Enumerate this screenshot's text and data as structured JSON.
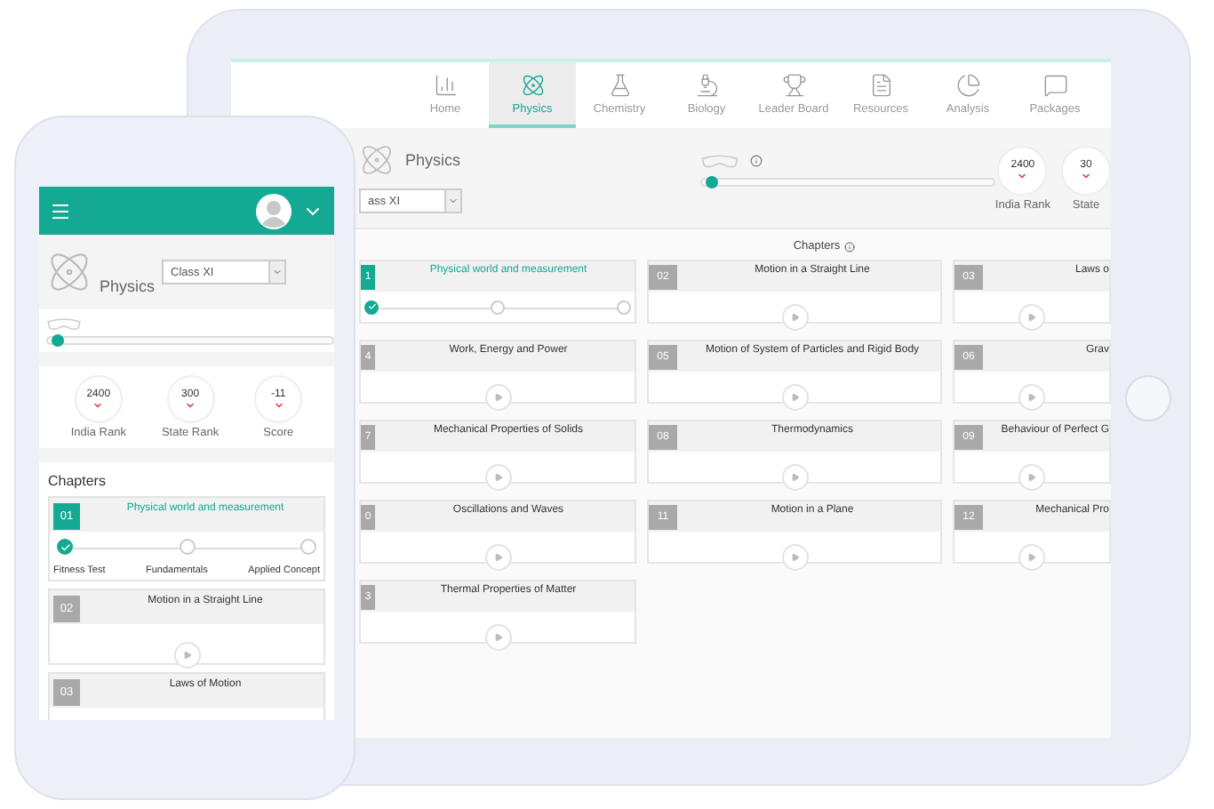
{
  "tablet": {
    "nav": [
      {
        "label": "Home",
        "selected": false
      },
      {
        "label": "Physics",
        "selected": true
      },
      {
        "label": "Chemistry",
        "selected": false
      },
      {
        "label": "Biology",
        "selected": false
      },
      {
        "label": "Leader Board",
        "selected": false
      },
      {
        "label": "Resources",
        "selected": false
      },
      {
        "label": "Analysis",
        "selected": false
      },
      {
        "label": "Packages",
        "selected": false
      }
    ],
    "header": {
      "subject": "Physics",
      "class_select": "ass XI",
      "progress": {
        "level": 0.02
      },
      "stats": [
        {
          "value": "2400",
          "label": "India Rank"
        },
        {
          "value": "30",
          "label": "State"
        }
      ]
    },
    "chapters_title": "Chapters",
    "chapters": [
      {
        "number": "1",
        "title": "Physical world and measurement",
        "selected": true,
        "steps": [
          {
            "done": true
          },
          {
            "done": false
          },
          {
            "done": false
          }
        ]
      },
      {
        "number": "02",
        "title": "Motion in a Straight Line",
        "selected": false
      },
      {
        "number": "03",
        "title": "Laws o",
        "selected": false
      },
      {
        "number": "4",
        "title": "Work, Energy and Power",
        "selected": false
      },
      {
        "number": "05",
        "title": "Motion of System of Particles and Rigid Body",
        "selected": false
      },
      {
        "number": "06",
        "title": "Grav",
        "selected": false
      },
      {
        "number": "7",
        "title": "Mechanical Properties of Solids",
        "selected": false
      },
      {
        "number": "08",
        "title": "Thermodynamics",
        "selected": false
      },
      {
        "number": "09",
        "title": "Behaviour of Perfect G",
        "selected": false
      },
      {
        "number": "0",
        "title": "Oscillations and Waves",
        "selected": false
      },
      {
        "number": "11",
        "title": "Motion in a Plane",
        "selected": false
      },
      {
        "number": "12",
        "title": "Mechanical Pro",
        "selected": false
      },
      {
        "number": "3",
        "title": "Thermal Properties of Matter",
        "selected": false
      }
    ]
  },
  "phone": {
    "subject": "Physics",
    "class_select": "Class XI",
    "progress": {
      "level": 0.02
    },
    "stats": [
      {
        "value": "2400",
        "label": "India Rank"
      },
      {
        "value": "300",
        "label": "State Rank"
      },
      {
        "value": "-11",
        "label": "Score"
      }
    ],
    "chapters_title": "Chapters",
    "chapters": [
      {
        "number": "01",
        "title": "Physical world and measurement",
        "selected": true,
        "steps": [
          {
            "label": "Fitness Test",
            "done": true
          },
          {
            "label": "Fundamentals",
            "done": false
          },
          {
            "label": "Applied Concept",
            "done": false
          }
        ]
      },
      {
        "number": "02",
        "title": "Motion in a Straight Line",
        "selected": false
      },
      {
        "number": "03",
        "title": "Laws of Motion",
        "selected": false
      }
    ]
  }
}
